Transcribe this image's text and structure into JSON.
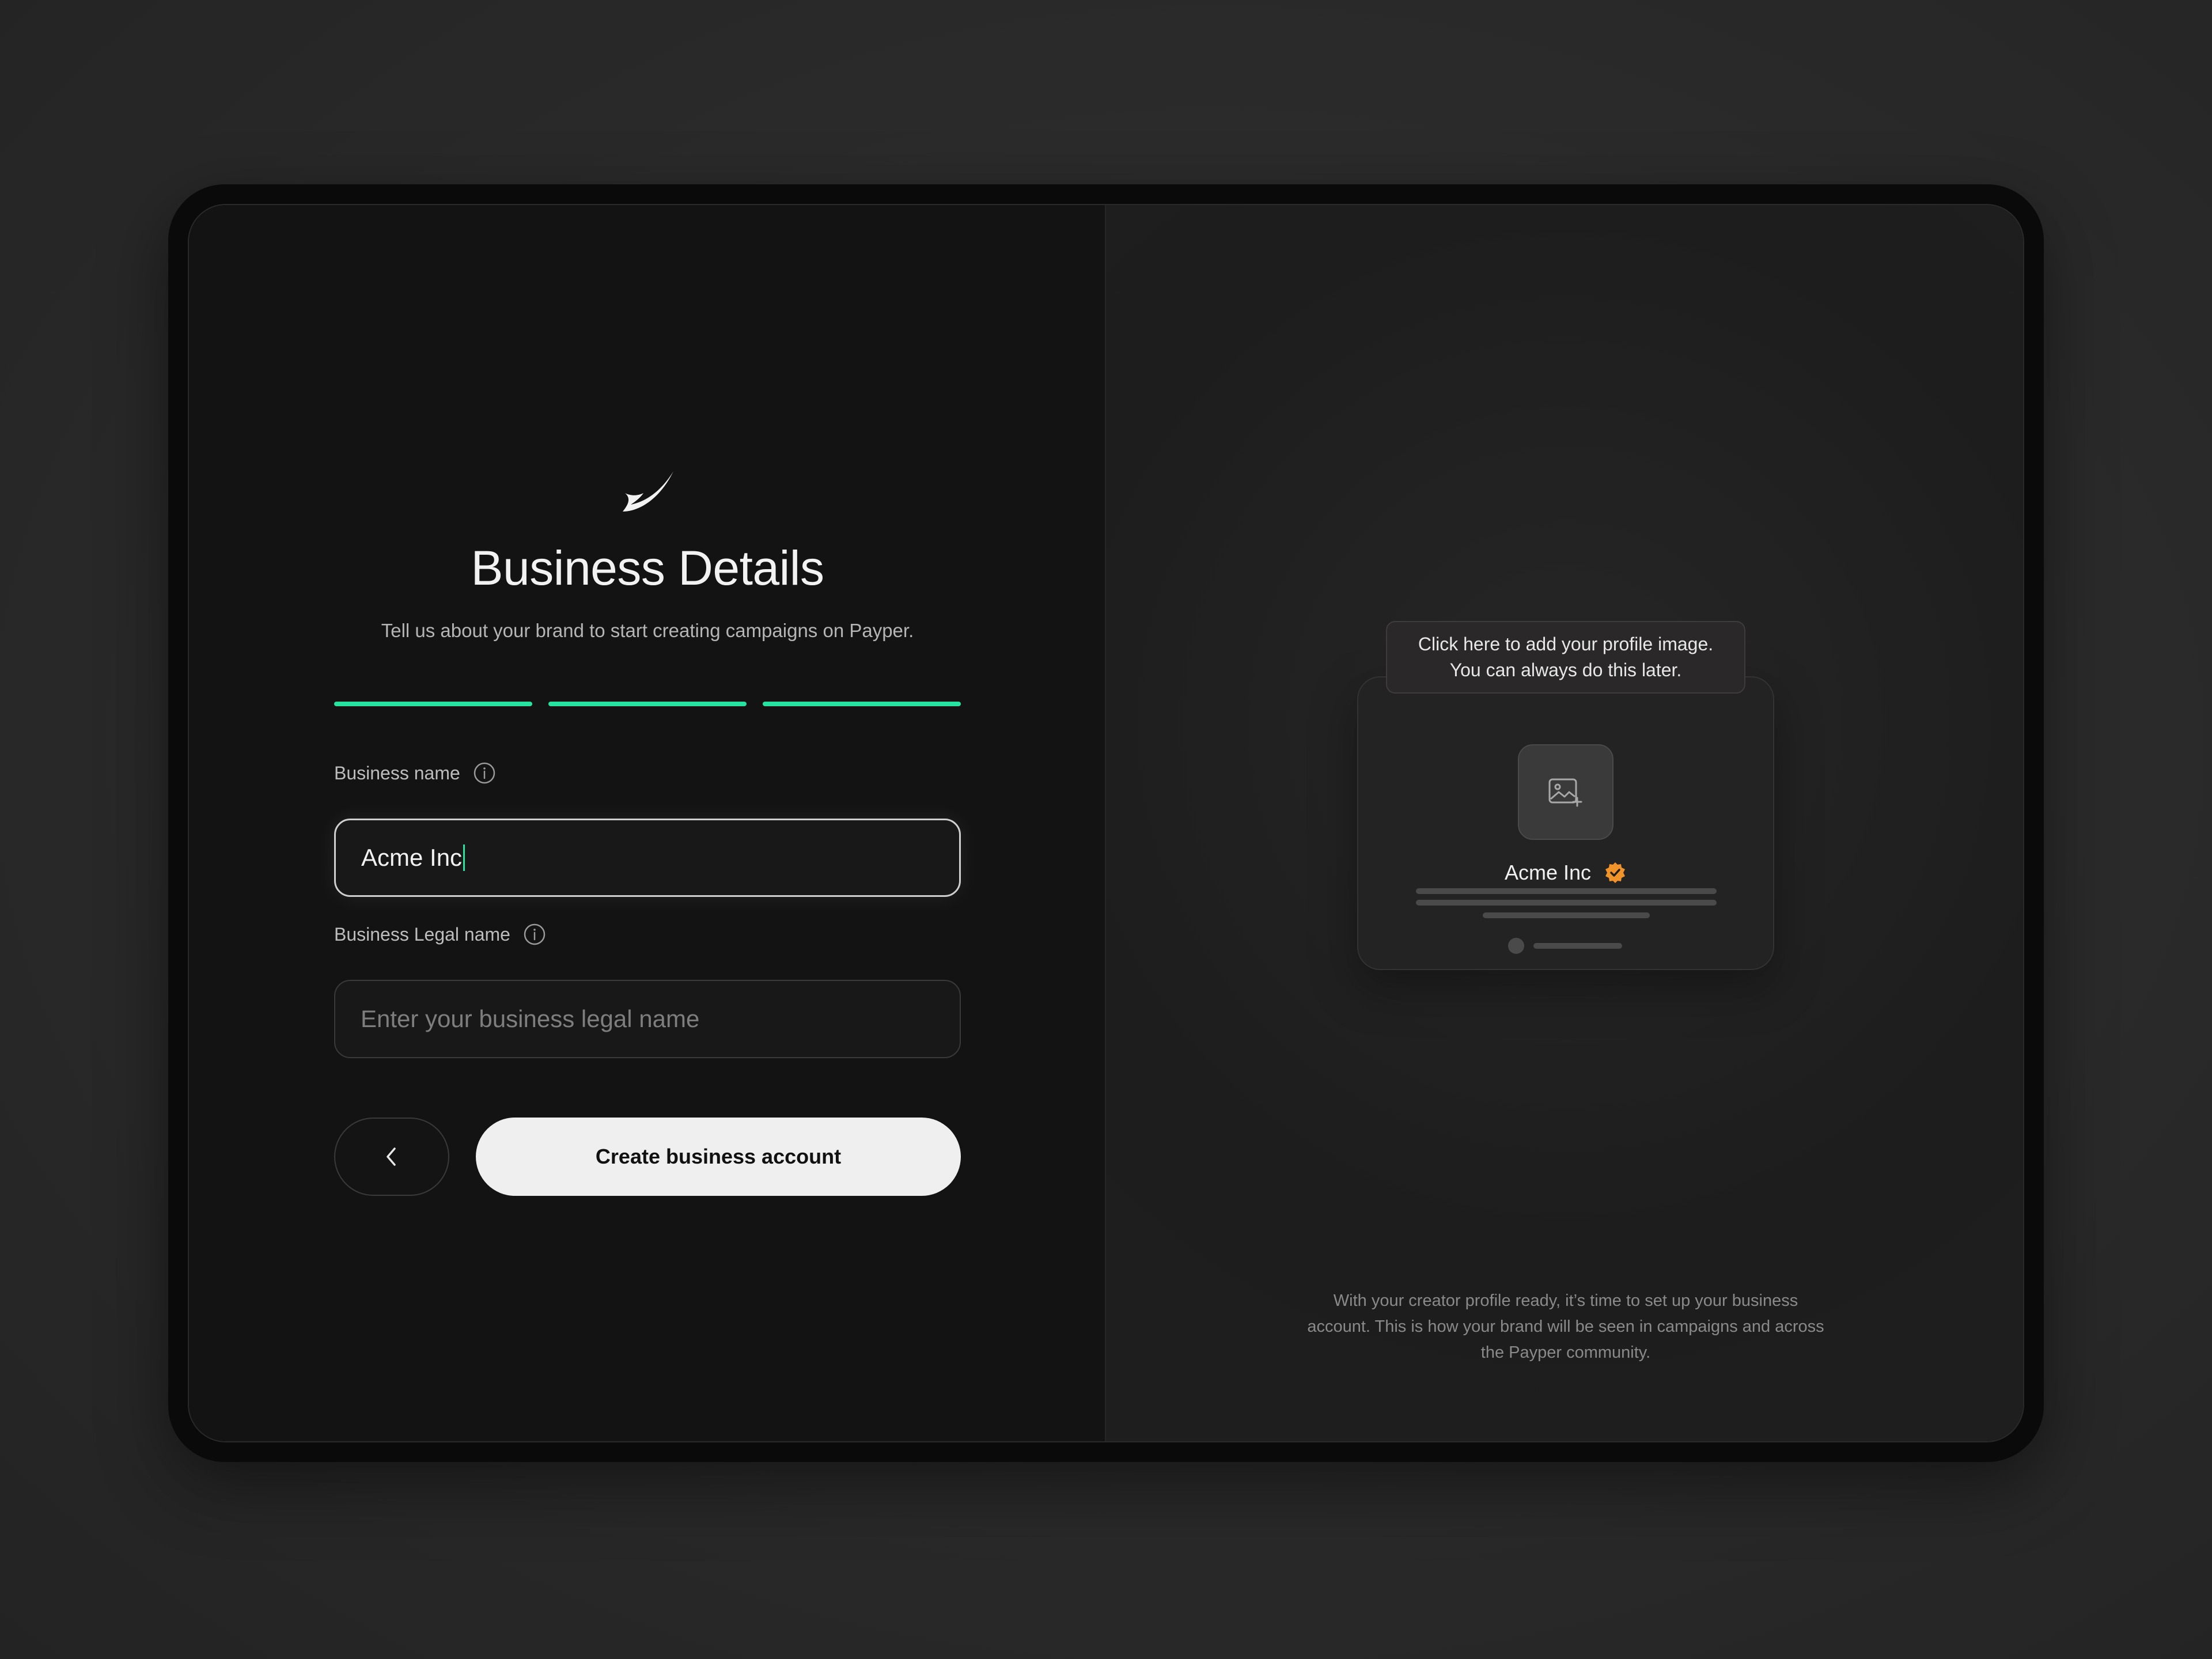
{
  "form": {
    "title": "Business Details",
    "subtitle": "Tell us about your brand to start creating campaigns on Payper.",
    "progress": {
      "steps_total": 3,
      "steps_completed": 3,
      "color": "#27e3a0"
    },
    "business_name": {
      "label": "Business name",
      "value": "Acme Inc",
      "info_icon": "info-icon"
    },
    "legal_name": {
      "label": "Business Legal name",
      "placeholder": "Enter your business legal name",
      "value": "",
      "info_icon": "info-icon"
    },
    "back_button": {
      "icon": "chevron-left-icon"
    },
    "submit_label": "Create business account"
  },
  "preview": {
    "tooltip_line1": "Click here to add your profile image.",
    "tooltip_line2": "You can always do this later.",
    "avatar_icon": "image-add-icon",
    "business_name": "Acme Inc",
    "verified_icon": "verified-badge-icon",
    "verified_color": "#f0932b",
    "caption": "With your creator profile ready, it’s time to set up your business account. This is how your brand will be seen in campaigns and across the Payper community."
  }
}
